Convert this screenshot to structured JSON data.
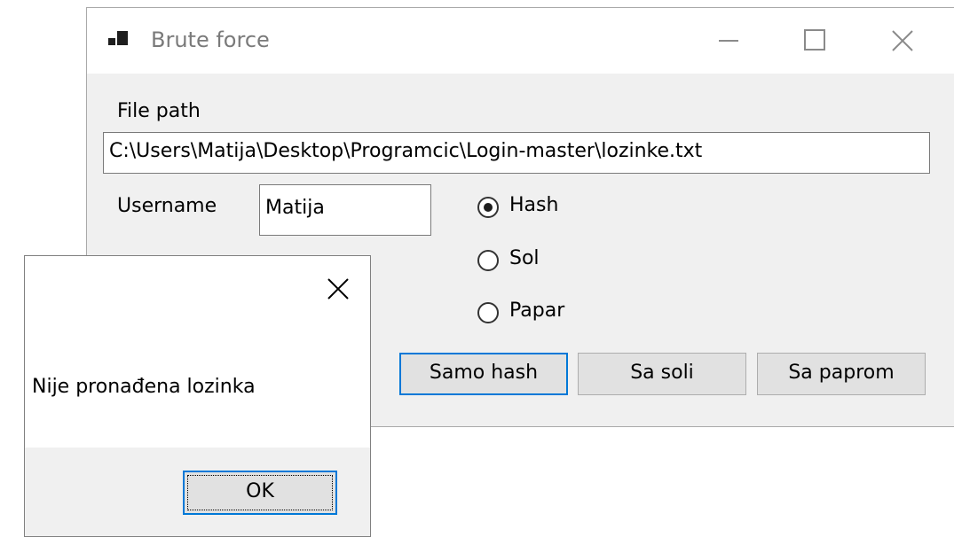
{
  "main_window": {
    "title": "Brute force",
    "file_path_label": "File path",
    "file_path_value": "C:\\Users\\Matija\\Desktop\\Programcic\\Login-master\\lozinke.txt",
    "username_label": "Username",
    "username_value": "Matija",
    "radio_options": [
      {
        "label": "Hash",
        "checked": true
      },
      {
        "label": "Sol",
        "checked": false
      },
      {
        "label": "Papar",
        "checked": false
      }
    ],
    "buttons": {
      "samo_hash": "Samo hash",
      "sa_soli": "Sa soli",
      "sa_paprom": "Sa paprom"
    },
    "icons": {
      "app": "app-icon",
      "minimize": "minimize-icon",
      "maximize": "maximize-icon",
      "close": "close-icon"
    }
  },
  "message_box": {
    "message": "Nije pronađena lozinka",
    "ok_label": "OK",
    "close_icon": "close-icon"
  },
  "colors": {
    "accent": "#0078d7",
    "window_bg": "#f0f0f0",
    "button_bg": "#e1e1e1"
  }
}
